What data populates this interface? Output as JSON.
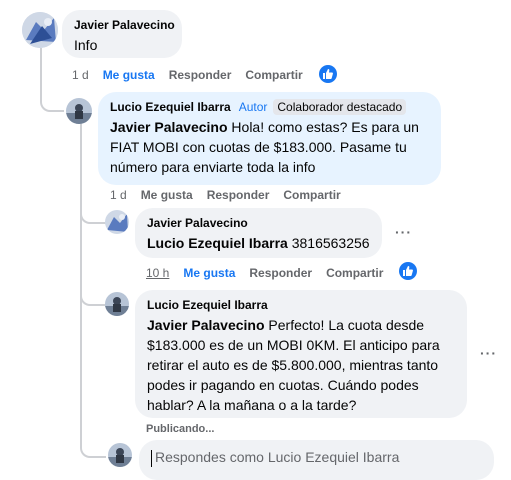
{
  "comment1": {
    "author": "Javier Palavecino",
    "text": "Info",
    "time": "1 d",
    "like_label": "Me gusta",
    "reply_label": "Responder",
    "share_label": "Compartir",
    "reaction_icon": "like-icon"
  },
  "reply1": {
    "author": "Lucio Ezequiel Ibarra",
    "author_tag": "Autor",
    "badge": "Colaborador destacado",
    "mention": "Javier Palavecino",
    "text": " Hola! como estas? Es para un FIAT MOBI con cuotas de $183.000. Pasame tu número para enviarte toda la info",
    "time": "1 d",
    "like_label": "Me gusta",
    "reply_label": "Responder",
    "share_label": "Compartir"
  },
  "reply2": {
    "author": "Javier Palavecino",
    "mention": "Lucio Ezequiel Ibarra",
    "text": " 3816563256",
    "time": "10 h",
    "like_label": "Me gusta",
    "reply_label": "Responder",
    "share_label": "Compartir",
    "reaction_icon": "like-icon"
  },
  "reply3": {
    "author": "Lucio Ezequiel Ibarra",
    "mention": "Javier Palavecino",
    "text": " Perfecto! La cuota desde $183.000 es de un MOBI 0KM. El anticipo para retirar el auto es de $5.800.000, mientras tanto podes ir pagando en cuotas. Cuándo podes hablar? A la mañana o a la tarde?",
    "status": "Publicando..."
  },
  "reply_box": {
    "placeholder": "Respondes como Lucio Ezequiel Ibarra"
  },
  "colors": {
    "accent": "#1877f2",
    "bubble": "#f0f2f5",
    "highlight_bubble": "#e7f3ff"
  }
}
